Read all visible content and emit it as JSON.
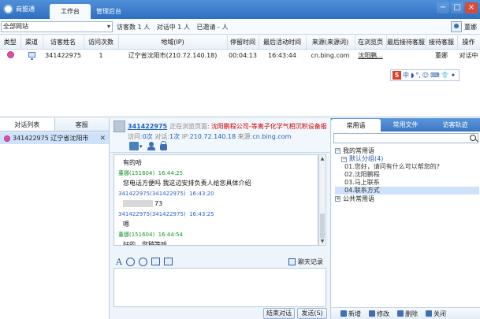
{
  "app": {
    "title": "商盟通"
  },
  "tabs": [
    "工作台",
    "管理后台"
  ],
  "window_controls": [
    "−",
    "□",
    "×"
  ],
  "filter": {
    "site_select": "全部网站",
    "visitor_count": "访客数 1 人",
    "in_chat": "对话中 1 人",
    "invited": "已邀请 - 人",
    "user_name": "董娜"
  },
  "visitor_table": {
    "headers": [
      "类型",
      "渠道",
      "访客姓名",
      "访问次数",
      "地域(IP)",
      "停留时间",
      "最后活动时间",
      "来源(来源词)",
      "在浏览页",
      "最后接待客服",
      "接待客服",
      "操作"
    ],
    "rows": [
      {
        "name": "341422975",
        "visits": "1",
        "region": "辽宁省沈阳市(210.72.140.18)",
        "duration": "00:04:13",
        "last_active": "16:43:44",
        "source": "cn.bing.com",
        "page": "沈阳鹏...",
        "last_agent": "",
        "agent": "董娜",
        "operation": "对话中"
      }
    ]
  },
  "ime_toolbar": {
    "logo": "S",
    "items": [
      "中",
      "◗",
      "°,",
      "☺",
      "⌨",
      "👕",
      "✦"
    ]
  },
  "left_panel": {
    "tabs": [
      "对话列表",
      "客服"
    ],
    "visitor_item": "341422975 辽宁省沈阳市"
  },
  "chat_header": {
    "visitor_id": "341422975",
    "browsing_label": "正在浏览页面:",
    "browsing_page": "沈阳鹏程公司-等离子化学气相沉积设备报价...",
    "info_visits_label": "访问:",
    "info_visits": "0次",
    "info_chats_label": "对话:",
    "info_chats": "1次",
    "info_ip_label": "IP:",
    "info_ip": "210.72.140.18",
    "info_source_label": "来源:",
    "info_source": "cn.bing.com"
  },
  "messages": [
    {
      "type": "body",
      "text": "有的哈"
    },
    {
      "type": "agent",
      "sender": "董娜(151604)",
      "time": "16:44:25"
    },
    {
      "type": "body",
      "text": "您电话方便吗  我这边安排负责人给您具体介绍"
    },
    {
      "type": "visitor",
      "sender": "341422975(341422975)",
      "time": "16:43:20"
    },
    {
      "type": "body-blur",
      "text": "73"
    },
    {
      "type": "visitor",
      "sender": "341422975(341422975)",
      "time": "16:43:25"
    },
    {
      "type": "body",
      "text": "嗯"
    },
    {
      "type": "agent",
      "sender": "董娜(151604)",
      "time": "16:44:54"
    },
    {
      "type": "body",
      "text": "好的，您稍等哈"
    }
  ],
  "input_toolbar": {
    "font_icon": "A",
    "history_label": "聊天记录"
  },
  "chat_buttons": {
    "end": "结束对话",
    "send": "发送(S)"
  },
  "right_panel": {
    "tabs": [
      "常用语",
      "常用文件",
      "访客轨迹"
    ],
    "tree": {
      "root1": "我的常用语",
      "group1": "默认分组(4)",
      "items": [
        "01.您好，请问有什么可以帮您的?",
        "02.沈阳鹏程",
        "03.马上联系",
        "04.联系方式"
      ],
      "root2": "公共常用语"
    },
    "bottom_buttons": [
      "新增",
      "修改",
      "删除",
      "关闭"
    ]
  }
}
